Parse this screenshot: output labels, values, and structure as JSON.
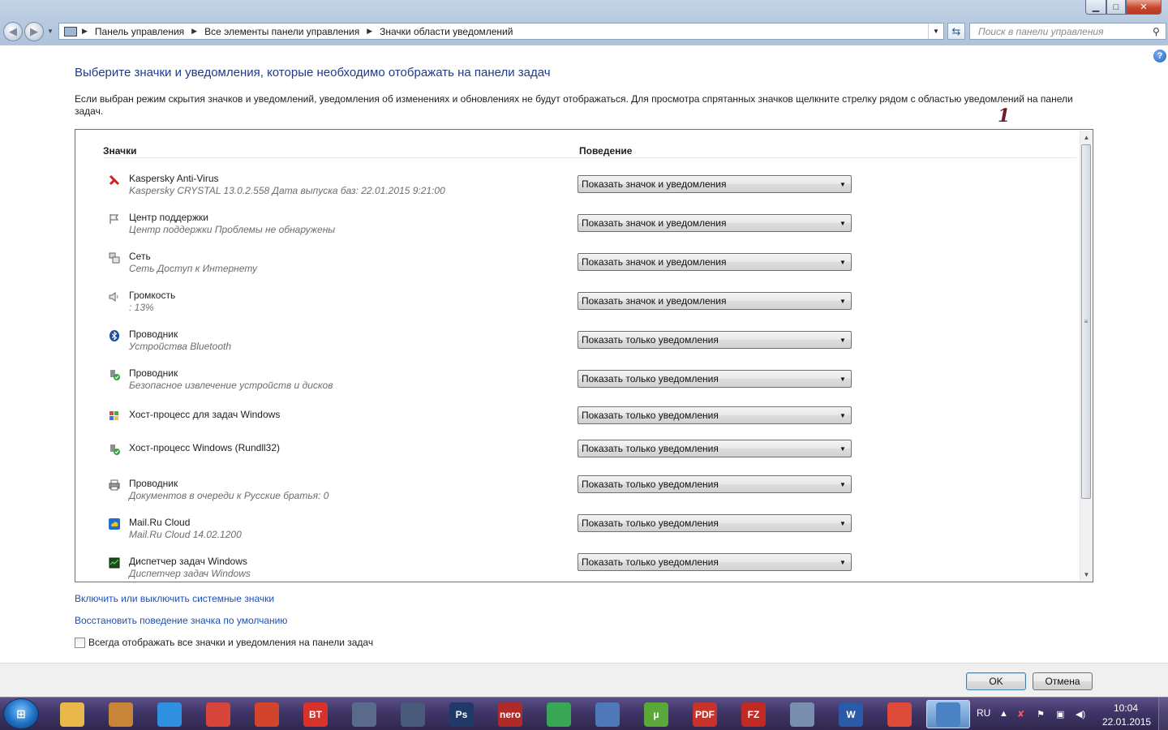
{
  "window": {
    "minimize_glyph": "▁",
    "maximize_glyph": "□",
    "close_glyph": "✕"
  },
  "address_bar": {
    "crumbs": [
      "Панель управления",
      "Все элементы панели управления",
      "Значки области уведомлений"
    ],
    "separator": "▶"
  },
  "search": {
    "placeholder": "Поиск в панели управления"
  },
  "page": {
    "title": "Выберите значки и уведомления, которые необходимо отображать на панели задач",
    "description": "Если выбран режим скрытия значков и уведомлений, уведомления об изменениях и обновлениях не будут отображаться. Для просмотра спрятанных значков щелкните стрелку рядом с областью уведомлений на панели задач."
  },
  "table": {
    "col_icons": "Значки",
    "col_behavior": "Поведение",
    "rows": [
      {
        "icon": "kaspersky-icon",
        "name": "Kaspersky Anti-Virus",
        "sub": "Kaspersky CRYSTAL 13.0.2.558 Дата выпуска баз: 22.01.2015 9:21:00",
        "behavior": "Показать значок и уведомления"
      },
      {
        "icon": "action-center-flag-icon",
        "name": "Центр поддержки",
        "sub": "Центр поддержки  Проблемы не обнаружены",
        "behavior": "Показать значок и уведомления"
      },
      {
        "icon": "network-icon",
        "name": "Сеть",
        "sub": "Сеть Доступ к Интернету",
        "behavior": "Показать значок и уведомления"
      },
      {
        "icon": "volume-icon",
        "name": "Громкость",
        "sub": ": 13%",
        "behavior": "Показать значок и уведомления"
      },
      {
        "icon": "bluetooth-icon",
        "name": "Проводник",
        "sub": "Устройства Bluetooth",
        "behavior": "Показать только уведомления"
      },
      {
        "icon": "safely-remove-icon",
        "name": "Проводник",
        "sub": "Безопасное извлечение устройств и дисков",
        "behavior": "Показать только уведомления"
      },
      {
        "icon": "windows-task-host-icon",
        "name": "Хост-процесс для задач Windows",
        "sub": "",
        "behavior": "Показать только уведомления"
      },
      {
        "icon": "rundll-host-icon",
        "name": "Хост-процесс Windows (Rundll32)",
        "sub": "",
        "behavior": "Показать только уведомления"
      },
      {
        "icon": "printer-icon",
        "name": "Проводник",
        "sub": "Документов в очереди к Русские  братья: 0",
        "behavior": "Показать только уведомления"
      },
      {
        "icon": "mailru-cloud-icon",
        "name": "Mail.Ru Cloud",
        "sub": "Mail.Ru Cloud 14.02.1200",
        "behavior": "Показать только уведомления"
      },
      {
        "icon": "task-manager-icon",
        "name": "Диспетчер задач Windows",
        "sub": "Диспетчер задач Windows",
        "behavior": "Показать только уведомления"
      }
    ]
  },
  "annotation": {
    "number": "1"
  },
  "links": {
    "toggle_system_icons": "Включить или выключить системные значки",
    "restore_defaults": "Восстановить поведение значка по умолчанию"
  },
  "always_show": {
    "label": "Всегда отображать все значки и уведомления на панели задач",
    "checked": false
  },
  "buttons": {
    "ok": "OK",
    "cancel": "Отмена"
  },
  "taskbar": {
    "apps": [
      {
        "icon": "file-explorer-icon",
        "label": "",
        "color": "#e8b84a"
      },
      {
        "icon": "contacts-icon",
        "label": "",
        "color": "#c7853a"
      },
      {
        "icon": "cloud-icon",
        "label": "",
        "color": "#2f8fe0"
      },
      {
        "icon": "target-icon",
        "label": "",
        "color": "#d8453b"
      },
      {
        "icon": "ccleaner-icon",
        "label": "",
        "color": "#d2442b"
      },
      {
        "icon": "bt-client-icon",
        "label": "BT",
        "color": "#d8322b"
      },
      {
        "icon": "media-center-icon",
        "label": "",
        "color": "#5a6a8a"
      },
      {
        "icon": "media-player-icon",
        "label": "",
        "color": "#4a5a7a"
      },
      {
        "icon": "photoshop-icon",
        "label": "Ps",
        "color": "#1f3a66"
      },
      {
        "icon": "nero-icon",
        "label": "nero",
        "color": "#b02a2a"
      },
      {
        "icon": "google-drive-icon",
        "label": "",
        "color": "#3aa757"
      },
      {
        "icon": "network-manager-icon",
        "label": "",
        "color": "#4f78b8"
      },
      {
        "icon": "utorrent-icon",
        "label": "µ",
        "color": "#5aa83a"
      },
      {
        "icon": "pdf-icon",
        "label": "PDF",
        "color": "#c7332b"
      },
      {
        "icon": "filezilla-icon",
        "label": "FZ",
        "color": "#bf2a22"
      },
      {
        "icon": "paint-icon",
        "label": "",
        "color": "#7a8fb0"
      },
      {
        "icon": "word-icon",
        "label": "W",
        "color": "#2b5ba8"
      },
      {
        "icon": "chrome-icon",
        "label": "",
        "color": "#dd4b39"
      },
      {
        "icon": "control-panel-icon",
        "label": "",
        "color": "#4b82c4"
      }
    ],
    "tray": {
      "language": "RU",
      "time": "10:04",
      "date": "22.01.2015"
    }
  }
}
